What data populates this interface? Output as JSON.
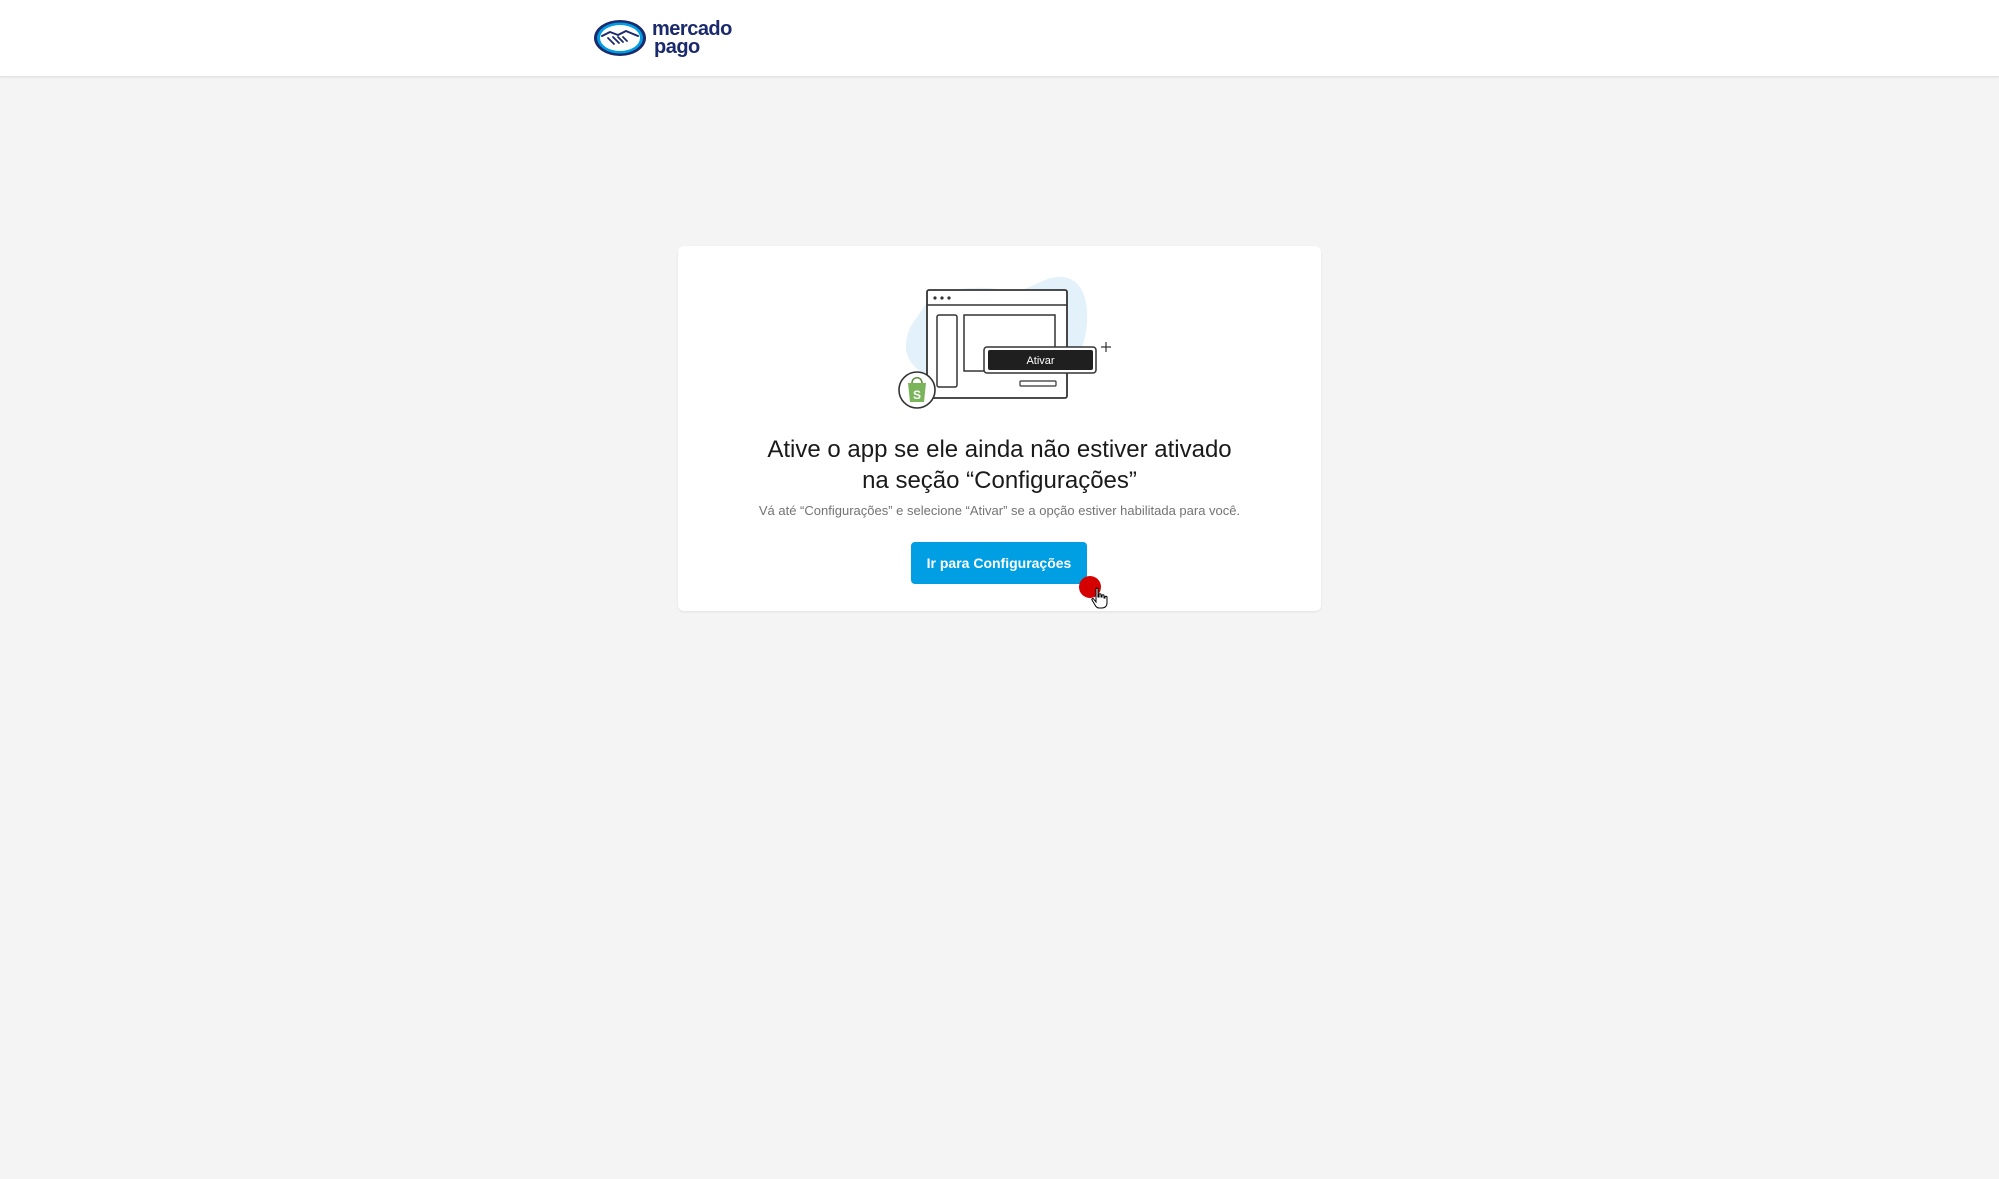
{
  "header": {
    "logo": {
      "line1": "mercado",
      "line2": "pago",
      "icon": "handshake-icon",
      "brand_color": "#1a2a6c",
      "accent_color": "#009ee3"
    }
  },
  "card": {
    "illustration": {
      "button_label": "Ativar",
      "icon": "shopify-bag-icon"
    },
    "title_line1": "Ative o app se ele ainda não estiver ativado",
    "title_line2": "na seção “Configurações”",
    "subtitle": "Vá até “Configurações” e selecione “Ativar” se a opção estiver habilitada para você.",
    "cta_label": "Ir para Configurações"
  },
  "colors": {
    "background": "#f4f4f4",
    "primary_button": "#009ee3",
    "click_marker": "#d50000"
  }
}
